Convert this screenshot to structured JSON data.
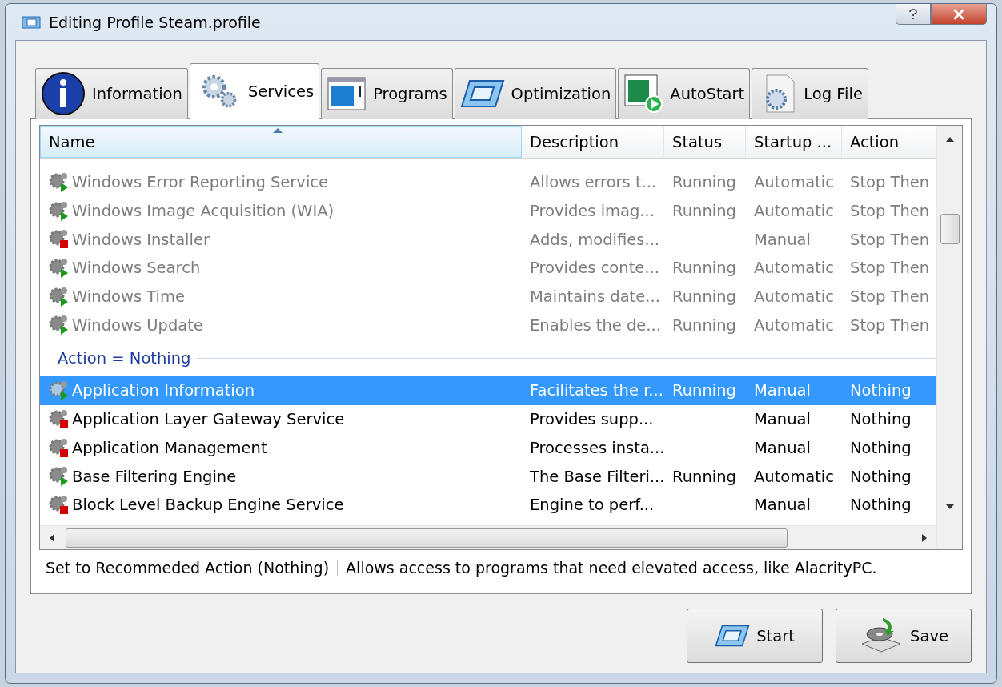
{
  "window": {
    "title": "Editing Profile Steam.profile"
  },
  "tabs": [
    {
      "label": "Information",
      "selected": false
    },
    {
      "label": "Services",
      "selected": true
    },
    {
      "label": "Programs",
      "selected": false
    },
    {
      "label": "Optimization",
      "selected": false
    },
    {
      "label": "AutoStart",
      "selected": false
    },
    {
      "label": "Log File",
      "selected": false
    }
  ],
  "table": {
    "columns": [
      {
        "label": "Name",
        "sorted": true
      },
      {
        "label": "Description",
        "sorted": false
      },
      {
        "label": "Status",
        "sorted": false
      },
      {
        "label": "Startup ...",
        "sorted": false
      },
      {
        "label": "Action",
        "sorted": false
      }
    ],
    "groups": [
      {
        "rows": [
          {
            "name": "Windows Error Reporting Service",
            "description": "Allows errors t...",
            "status": "Running",
            "startup": "Automatic",
            "action": "Stop Then",
            "running": true,
            "dimmed": true,
            "selected": false
          },
          {
            "name": "Windows Image Acquisition (WIA)",
            "description": "Provides imag...",
            "status": "Running",
            "startup": "Automatic",
            "action": "Stop Then",
            "running": true,
            "dimmed": true,
            "selected": false
          },
          {
            "name": "Windows Installer",
            "description": "Adds, modifies...",
            "startup": "Manual",
            "action": "Stop Then",
            "running": false,
            "dimmed": true,
            "selected": false
          },
          {
            "name": "Windows Search",
            "description": "Provides conte...",
            "status": "Running",
            "startup": "Automatic",
            "action": "Stop Then",
            "running": true,
            "dimmed": true,
            "selected": false
          },
          {
            "name": "Windows Time",
            "description": "Maintains date...",
            "status": "Running",
            "startup": "Automatic",
            "action": "Stop Then",
            "running": true,
            "dimmed": true,
            "selected": false
          },
          {
            "name": "Windows Update",
            "description": "Enables the de...",
            "status": "Running",
            "startup": "Automatic",
            "action": "Stop Then",
            "running": true,
            "dimmed": true,
            "selected": false
          }
        ]
      },
      {
        "header": "Action = Nothing",
        "rows": [
          {
            "name": "Application Information",
            "description": "Facilitates the r...",
            "status": "Running",
            "startup": "Manual",
            "action": "Nothing",
            "running": true,
            "dimmed": false,
            "selected": true
          },
          {
            "name": "Application Layer Gateway Service",
            "description": "Provides supp...",
            "startup": "Manual",
            "action": "Nothing",
            "running": false,
            "dimmed": false,
            "selected": false
          },
          {
            "name": "Application Management",
            "description": "Processes insta...",
            "startup": "Manual",
            "action": "Nothing",
            "running": false,
            "dimmed": false,
            "selected": false
          },
          {
            "name": "Base Filtering Engine",
            "description": "The Base Filteri...",
            "status": "Running",
            "startup": "Automatic",
            "action": "Nothing",
            "running": true,
            "dimmed": false,
            "selected": false
          },
          {
            "name": "Block Level Backup Engine Service",
            "description": "Engine to perf...",
            "startup": "Manual",
            "action": "Nothing",
            "running": false,
            "dimmed": false,
            "selected": false
          }
        ]
      }
    ]
  },
  "status_bar": {
    "action_label": "Set to Recommeded Action (Nothing)",
    "description": "Allows access to programs that need elevated access, like AlacrityPC."
  },
  "buttons": [
    {
      "label": "Start"
    },
    {
      "label": "Save"
    }
  ]
}
